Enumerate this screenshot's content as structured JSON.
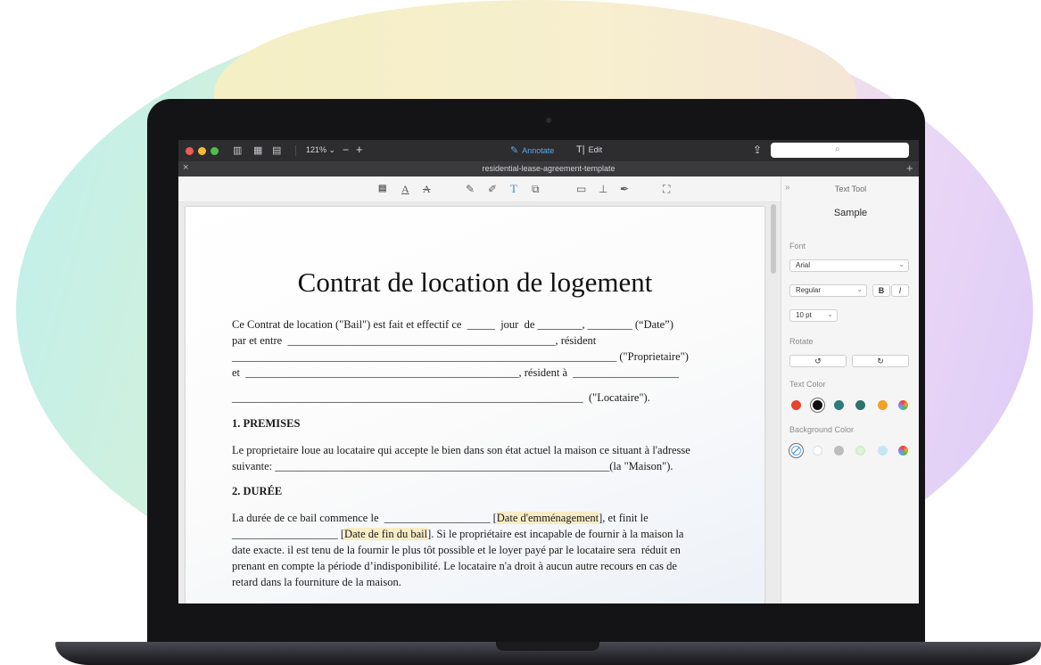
{
  "toolbar": {
    "zoom": "121%",
    "zoom_chevron": "⌄",
    "minus": "−",
    "plus": "+",
    "annotate_label": "Annotate",
    "edit_label": "Edit",
    "search_icon": "⌕",
    "share_icon": "⇪"
  },
  "tab": {
    "title": "residential-lease-agreement-template",
    "close": "×",
    "add": "+"
  },
  "tools": [
    "text-box-icon",
    "text-style-icon",
    "strikethrough-icon",
    "pencil-icon",
    "eraser-icon",
    "text-tool-icon",
    "shape-icon",
    "note-icon",
    "stamp-icon",
    "signature-icon",
    "crop-icon"
  ],
  "document": {
    "title": "Contrat de location de logement",
    "lines": [
      "Ce Contrat de location (\"Bail\") est fait et effectif ce  _____  jour  de ________, ________ (“Date”)",
      "par et entre  ________________________________________________, résident",
      "_____________________________________________________________________ (\"Proprietaire\")",
      "et  _________________________________________________, résident à  ___________________",
      "_______________________________________________________________  (\"Locataire\")."
    ],
    "section1_heading": "1. PREMISES",
    "section1_lines": [
      "Le proprietaire loue au locataire qui accepte le bien dans son état actuel la maison ce situant à l'adresse",
      "suivante: ____________________________________________________________(la \"Maison\")."
    ],
    "section2_heading": "2. DURÉE",
    "s2_line1_pre": "La durée de ce bail commence le  ___________________ [",
    "s2_line1_hl": "Date d'emménagement",
    "s2_line1_post": "], et finit le",
    "s2_line2_pre": "___________________ [",
    "s2_line2_hl": "Date de fin du bail",
    "s2_line2_post": "]. Si le propriétaire est incapable de fournir à la maison la",
    "s2_lines_rest": [
      "date exacte. il est tenu de la fournir le plus tôt possible et le loyer payé par le locataire sera  réduit en",
      "prenant en compte la période d’indisponibilité. Le locataire n'a droit à aucun autre recours en cas de",
      "retard dans la fourniture de la maison."
    ]
  },
  "panel": {
    "collapse": "»",
    "title": "Text Tool",
    "sample": "Sample",
    "font_label": "Font",
    "font_value": "Arial",
    "style_value": "Regular",
    "bold": "B",
    "italic": "I",
    "size_value": "10 pt",
    "rotate_label": "Rotate",
    "rotate_left": "↺",
    "rotate_right": "↻",
    "text_color_label": "Text Color",
    "text_colors": [
      "#e8432e",
      "#111111",
      "#2a7d7b",
      "#2d7470",
      "#f0a12a",
      "multicolor"
    ],
    "bg_color_label": "Background Color",
    "bg_colors": [
      "none",
      "#ffffff",
      "#bdbdbd",
      "#c9ecc2",
      "#c7e4f2",
      "multicolor"
    ]
  }
}
